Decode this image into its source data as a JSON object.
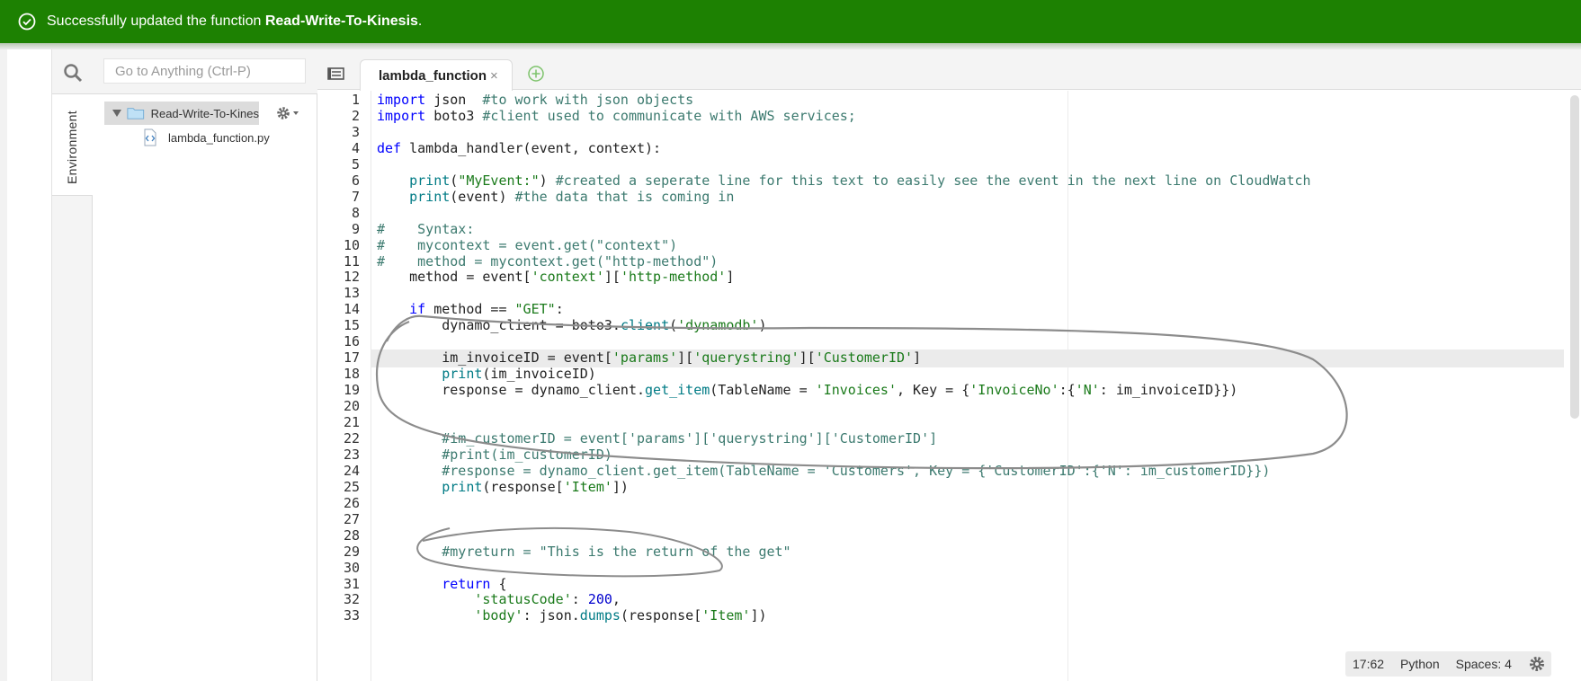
{
  "banner": {
    "prefix": "Successfully updated the function ",
    "function_name": "Read-Write-To-Kinesis",
    "suffix": ".",
    "color": "#1d8102",
    "icon": "check-circle-icon"
  },
  "search": {
    "placeholder": "Go to Anything (Ctrl-P)",
    "icon": "search-icon"
  },
  "sidebar": {
    "environment_label": "Environment"
  },
  "tree": {
    "root_folder": "Read-Write-To-Kines",
    "file": "lambda_function.py"
  },
  "tabs": [
    {
      "label": "lambda_function",
      "close": "×"
    }
  ],
  "editor": {
    "active_line": 17,
    "lines": [
      {
        "n": "1",
        "t": "import json  #to work with json objects"
      },
      {
        "n": "2",
        "t": "import boto3 #client used to communicate with AWS services;"
      },
      {
        "n": "3",
        "t": ""
      },
      {
        "n": "4",
        "t": "def lambda_handler(event, context):"
      },
      {
        "n": "5",
        "t": ""
      },
      {
        "n": "6",
        "t": "    print(\"MyEvent:\") #created a seperate line for this text to easily see the event in the next line on CloudWatch"
      },
      {
        "n": "7",
        "t": "    print(event) #the data that is coming in"
      },
      {
        "n": "8",
        "t": ""
      },
      {
        "n": "9",
        "t": "#    Syntax:"
      },
      {
        "n": "10",
        "t": "#    mycontext = event.get(\"context\")"
      },
      {
        "n": "11",
        "t": "#    method = mycontext.get(\"http-method\")"
      },
      {
        "n": "12",
        "t": "    method = event['context']['http-method']"
      },
      {
        "n": "13",
        "t": ""
      },
      {
        "n": "14",
        "t": "    if method == \"GET\":"
      },
      {
        "n": "15",
        "t": "        dynamo_client = boto3.client('dynamodb')"
      },
      {
        "n": "16",
        "t": ""
      },
      {
        "n": "17",
        "t": "        im_invoiceID = event['params']['querystring']['CustomerID']"
      },
      {
        "n": "18",
        "t": "        print(im_invoiceID)"
      },
      {
        "n": "19",
        "t": "        response = dynamo_client.get_item(TableName = 'Invoices', Key = {'InvoiceNo':{'N': im_invoiceID}})"
      },
      {
        "n": "20",
        "t": ""
      },
      {
        "n": "21",
        "t": ""
      },
      {
        "n": "22",
        "t": "        #im_customerID = event['params']['querystring']['CustomerID']"
      },
      {
        "n": "23",
        "t": "        #print(im_customerID)"
      },
      {
        "n": "24",
        "t": "        #response = dynamo_client.get_item(TableName = 'Customers', Key = {'CustomerID':{'N': im_customerID}})"
      },
      {
        "n": "25",
        "t": "        print(response['Item'])"
      },
      {
        "n": "26",
        "t": ""
      },
      {
        "n": "27",
        "t": ""
      },
      {
        "n": "28",
        "t": ""
      },
      {
        "n": "29",
        "t": "        #myreturn = \"This is the return of the get\""
      },
      {
        "n": "30",
        "t": ""
      },
      {
        "n": "31",
        "t": "        return {"
      },
      {
        "n": "32",
        "t": "            'statusCode': 200,"
      },
      {
        "n": "33",
        "t": "            'body': json.dumps(response['Item'])"
      }
    ]
  },
  "status": {
    "cursor": "17:62",
    "language": "Python",
    "indent": "Spaces: 4",
    "icon": "gear-icon"
  }
}
